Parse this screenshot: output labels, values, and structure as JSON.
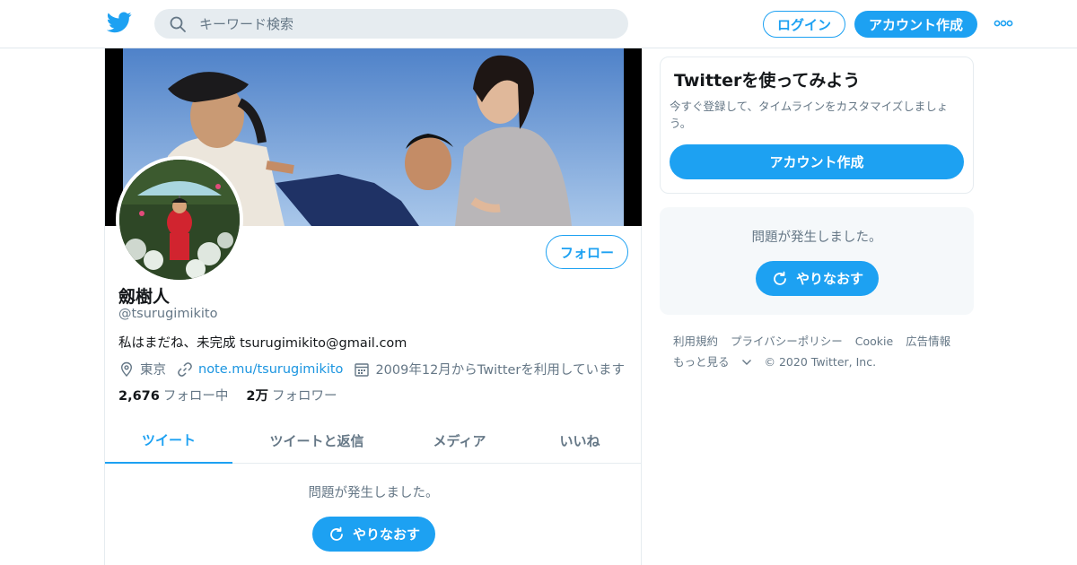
{
  "topbar": {
    "logo_icon": "twitter-bird-icon",
    "search_placeholder": "キーワード検索",
    "login_label": "ログイン",
    "signup_label": "アカウント作成",
    "more_icon": "more-dots-icon"
  },
  "profile": {
    "name": "劔樹人",
    "handle": "@tsurugimikito",
    "bio": "私はまだね、未完成 tsurugimikito@gmail.com",
    "location": "東京",
    "website": "note.mu/tsurugimikito",
    "joined": "2009年12月からTwitterを利用しています",
    "following_count": "2,676",
    "following_label": "フォロー中",
    "followers_count": "2万",
    "followers_label": "フォロワー",
    "follow_button": "フォロー"
  },
  "tabs": [
    {
      "label": "ツイート",
      "active": true
    },
    {
      "label": "ツイートと返信",
      "active": false
    },
    {
      "label": "メディア",
      "active": false
    },
    {
      "label": "いいね",
      "active": false
    }
  ],
  "timeline": {
    "error_message": "問題が発生しました。",
    "retry_label": "やりなおす"
  },
  "sidebar": {
    "signup_card": {
      "title": "Twitterを使ってみよう",
      "subtitle": "今すぐ登録して、タイムラインをカスタマイズしましょう。",
      "button": "アカウント作成"
    },
    "error_card": {
      "message": "問題が発生しました。",
      "retry_label": "やりなおす"
    },
    "footer": {
      "links": [
        "利用規約",
        "プライバシーポリシー",
        "Cookie",
        "広告情報"
      ],
      "more": "もっと見る",
      "copyright": "© 2020 Twitter, Inc."
    }
  },
  "colors": {
    "accent": "#1da1f2",
    "text_secondary": "#657786",
    "link": "#1b95e0"
  }
}
